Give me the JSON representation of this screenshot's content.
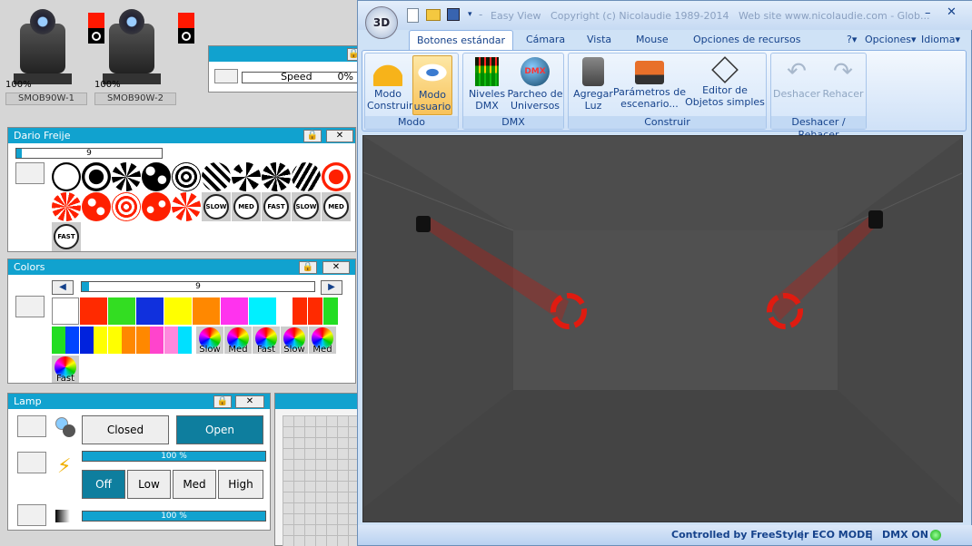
{
  "fixtures": [
    {
      "percent": "100%",
      "name": "SMOB90W-1"
    },
    {
      "percent": "100%",
      "name": "SMOB90W-2"
    }
  ],
  "speed_panel": {
    "label": "Speed",
    "value": "0%"
  },
  "gobo_panel": {
    "title": "Dario Freije",
    "value": "9",
    "speed_buttons": [
      "SLOW",
      "MED",
      "FAST",
      "SLOW",
      "MED",
      "FAST"
    ]
  },
  "colors_panel": {
    "title": "Colors",
    "value": "9",
    "palette": [
      "#ffffff",
      "#ff2a00",
      "#33dd22",
      "#1030dd",
      "#ffff00",
      "#ff8800",
      "#ff33ee",
      "#00f0ff",
      "#ffffff",
      "#ff2a00",
      "#ff2a00",
      "#22dd22"
    ],
    "split_row": [
      [
        "#22dd22",
        "#0044ff"
      ],
      [
        "#0022dd",
        "#ffff00"
      ],
      [
        "#ffff00",
        "#ff8800"
      ],
      [
        "#ff8800",
        "#ff44cc"
      ],
      [
        "#ff88dd",
        "#00e0ff"
      ]
    ],
    "wheel_labels": [
      "Slow",
      "Med",
      "Fast",
      "Slow",
      "Med",
      "Fast"
    ]
  },
  "lamp_panel": {
    "title": "Lamp",
    "closed_label": "Closed",
    "open_label": "Open",
    "dimmer": "100 %",
    "strobe": "100 %",
    "levels": [
      "Off",
      "Low",
      "Med",
      "High"
    ]
  },
  "window": {
    "title": "Easy View",
    "copyright": "Copyright (c) Nicolaudie 1989-2014",
    "website": "Web site www.nicolaudie.com - Glob..."
  },
  "tabs": [
    "Botones estándar",
    "Cámara",
    "Vista",
    "Mouse",
    "Opciones de recursos"
  ],
  "menu": {
    "help": "?",
    "options": "Opciones",
    "language": "Idioma"
  },
  "ribbon": {
    "modo": {
      "label": "Modo",
      "construir": [
        "Modo",
        "Construir"
      ],
      "usuario": [
        "Modo",
        "usuario"
      ]
    },
    "dmx": {
      "label": "DMX",
      "niveles": [
        "Niveles",
        "DMX"
      ],
      "parcheo": [
        "Parcheo de",
        "Universos"
      ],
      "dmx_icon": "DMX"
    },
    "construir": {
      "label": "Construir",
      "agregar": [
        "Agregar",
        "Luz"
      ],
      "parametros": [
        "Parámetros de",
        "escenario..."
      ],
      "editor": [
        "Editor de",
        "Objetos simples"
      ]
    },
    "undo": {
      "label": "Deshacer / Rehacer",
      "deshacer": "Deshacer",
      "rehacer": "Rehacer"
    }
  },
  "status": {
    "controlled": "Controlled by FreeStyler",
    "eco": "ECO MODE",
    "dmx": "DMX ON"
  },
  "colors": {
    "accent": "#11a2cf",
    "dark_teal": "#0e7e9e",
    "ribbon_text": "#15428b",
    "beam": "#e01b10"
  }
}
